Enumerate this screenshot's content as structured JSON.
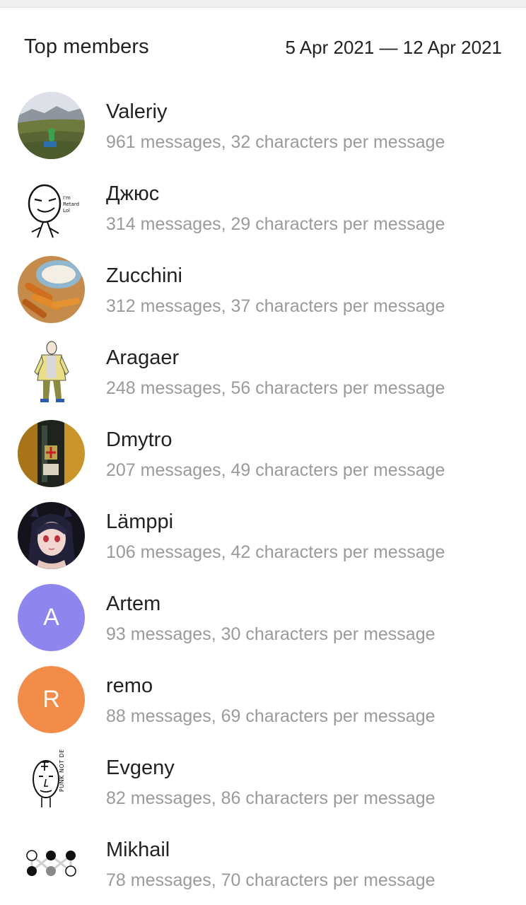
{
  "header": {
    "title": "Top members",
    "date_range": "5 Apr 2021 — 12 Apr 2021"
  },
  "members": [
    {
      "name": "Valeriy",
      "meta": "961 messages, 32 characters per message",
      "avatar": "photo-mountain-meadow"
    },
    {
      "name": "Джюс",
      "meta": "314 messages, 29 characters per message",
      "avatar": "meme-face-drawing",
      "avatar_text": "I'm Retard Lol"
    },
    {
      "name": "Zucchini",
      "meta": "312 messages, 37 characters per message",
      "avatar": "photo-fried-zucchini"
    },
    {
      "name": "Aragaer",
      "meta": "248 messages, 56 characters per message",
      "avatar": "cartoon-man-yellow-jacket"
    },
    {
      "name": "Dmytro",
      "meta": "207 messages, 49 characters per message",
      "avatar": "photo-can-dark"
    },
    {
      "name": "Lämppi",
      "meta": "106 messages, 42 characters per message",
      "avatar": "anime-girl-portrait"
    },
    {
      "name": "Artem",
      "meta": "93 messages, 30 characters per message",
      "avatar": "letter",
      "letter": "A",
      "color": "#8e85ee"
    },
    {
      "name": "remo",
      "meta": "88 messages, 69 characters per message",
      "avatar": "letter",
      "letter": "R",
      "color": "#f28c48"
    },
    {
      "name": "Evgeny",
      "meta": "82 messages, 86 characters per message",
      "avatar": "punk-face-drawing",
      "avatar_text": "PUNK NOT DEAD"
    },
    {
      "name": "Mikhail",
      "meta": "78 messages, 70 characters per message",
      "avatar": "dots-pattern"
    }
  ]
}
